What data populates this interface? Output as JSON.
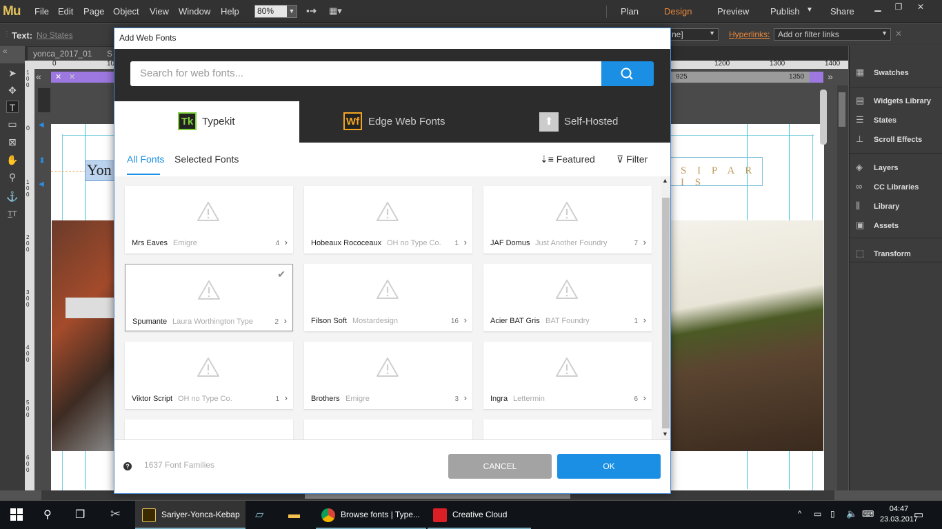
{
  "app": {
    "logo": "Mu",
    "menus": [
      "File",
      "Edit",
      "Page",
      "Object",
      "View",
      "Window",
      "Help"
    ],
    "zoom": "80%",
    "modes": {
      "plan": "Plan",
      "design": "Design",
      "preview": "Preview",
      "publish": "Publish",
      "share": "Share"
    },
    "accent": "#e9883a"
  },
  "control_bar": {
    "text_label": "Text:",
    "states_label": "No States",
    "state_box": "ne]",
    "hyperlinks_label": "Hyperlinks:",
    "links_placeholder": "Add or filter links"
  },
  "doc_tab": "yonca_2017_01",
  "ruler": {
    "ticks": [
      "0",
      "10",
      "1200",
      "1300",
      "1400"
    ],
    "mark_925": "925",
    "mark_1350": "1350"
  },
  "vruler": [
    "1 0 0",
    "0",
    "1 0 0",
    "2 0 0",
    "3 0 0",
    "4 0 0",
    "5 0 0",
    "6 0 0"
  ],
  "canvas": {
    "yonca_text": "Yon",
    "siparis_text": "S I P A R I S"
  },
  "right_panel": {
    "items": [
      {
        "icon": "swatches-icon",
        "label": "Swatches"
      },
      {
        "icon": "widgets-icon",
        "label": "Widgets Library"
      },
      {
        "icon": "states-icon",
        "label": "States"
      },
      {
        "icon": "scroll-effects-icon",
        "label": "Scroll Effects"
      },
      {
        "icon": "layers-icon",
        "label": "Layers"
      },
      {
        "icon": "cc-libraries-icon",
        "label": "CC Libraries"
      },
      {
        "icon": "library-icon",
        "label": "Library"
      },
      {
        "icon": "assets-icon",
        "label": "Assets"
      },
      {
        "icon": "transform-icon",
        "label": "Transform"
      }
    ]
  },
  "dialog": {
    "title": "Add Web Fonts",
    "search_placeholder": "Search for web fonts...",
    "tabs": [
      {
        "badge": "Tk",
        "label": "Typekit"
      },
      {
        "badge": "Wf",
        "label": "Edge Web Fonts"
      },
      {
        "badge": "⬆",
        "label": "Self-Hosted"
      }
    ],
    "subtabs": {
      "all": "All Fonts",
      "selected": "Selected Fonts"
    },
    "sort": "Featured",
    "filter": "Filter",
    "fonts": [
      {
        "name": "Mrs Eaves",
        "designer": "Emigre",
        "count": "4"
      },
      {
        "name": "Hobeaux Rococeaux",
        "designer": "OH no Type Co.",
        "count": "1"
      },
      {
        "name": "JAF Domus",
        "designer": "Just Another Foundry",
        "count": "7"
      },
      {
        "name": "Spumante",
        "designer": "Laura Worthington Type",
        "count": "2",
        "selected": true
      },
      {
        "name": "Filson Soft",
        "designer": "Mostardesign",
        "count": "16"
      },
      {
        "name": "Acier BAT Gris",
        "designer": "BAT Foundry",
        "count": "1"
      },
      {
        "name": "Viktor Script",
        "designer": "OH no Type Co.",
        "count": "1"
      },
      {
        "name": "Brothers",
        "designer": "Emigre",
        "count": "3"
      },
      {
        "name": "Ingra",
        "designer": "Lettermin",
        "count": "6"
      }
    ],
    "font_families": "1637 Font Families",
    "cancel": "CANCEL",
    "ok": "OK",
    "accent": "#1a8fe3"
  },
  "taskbar": {
    "items": [
      {
        "label": "Sariyer-Yonca-Kebap",
        "color": "#e2c05b"
      },
      {
        "label": "Browse fonts | Type...",
        "color": "#4285f4"
      },
      {
        "label": "Creative Cloud",
        "color": "#da1f26"
      }
    ],
    "time": "04:47",
    "date": "23.03.2017"
  }
}
